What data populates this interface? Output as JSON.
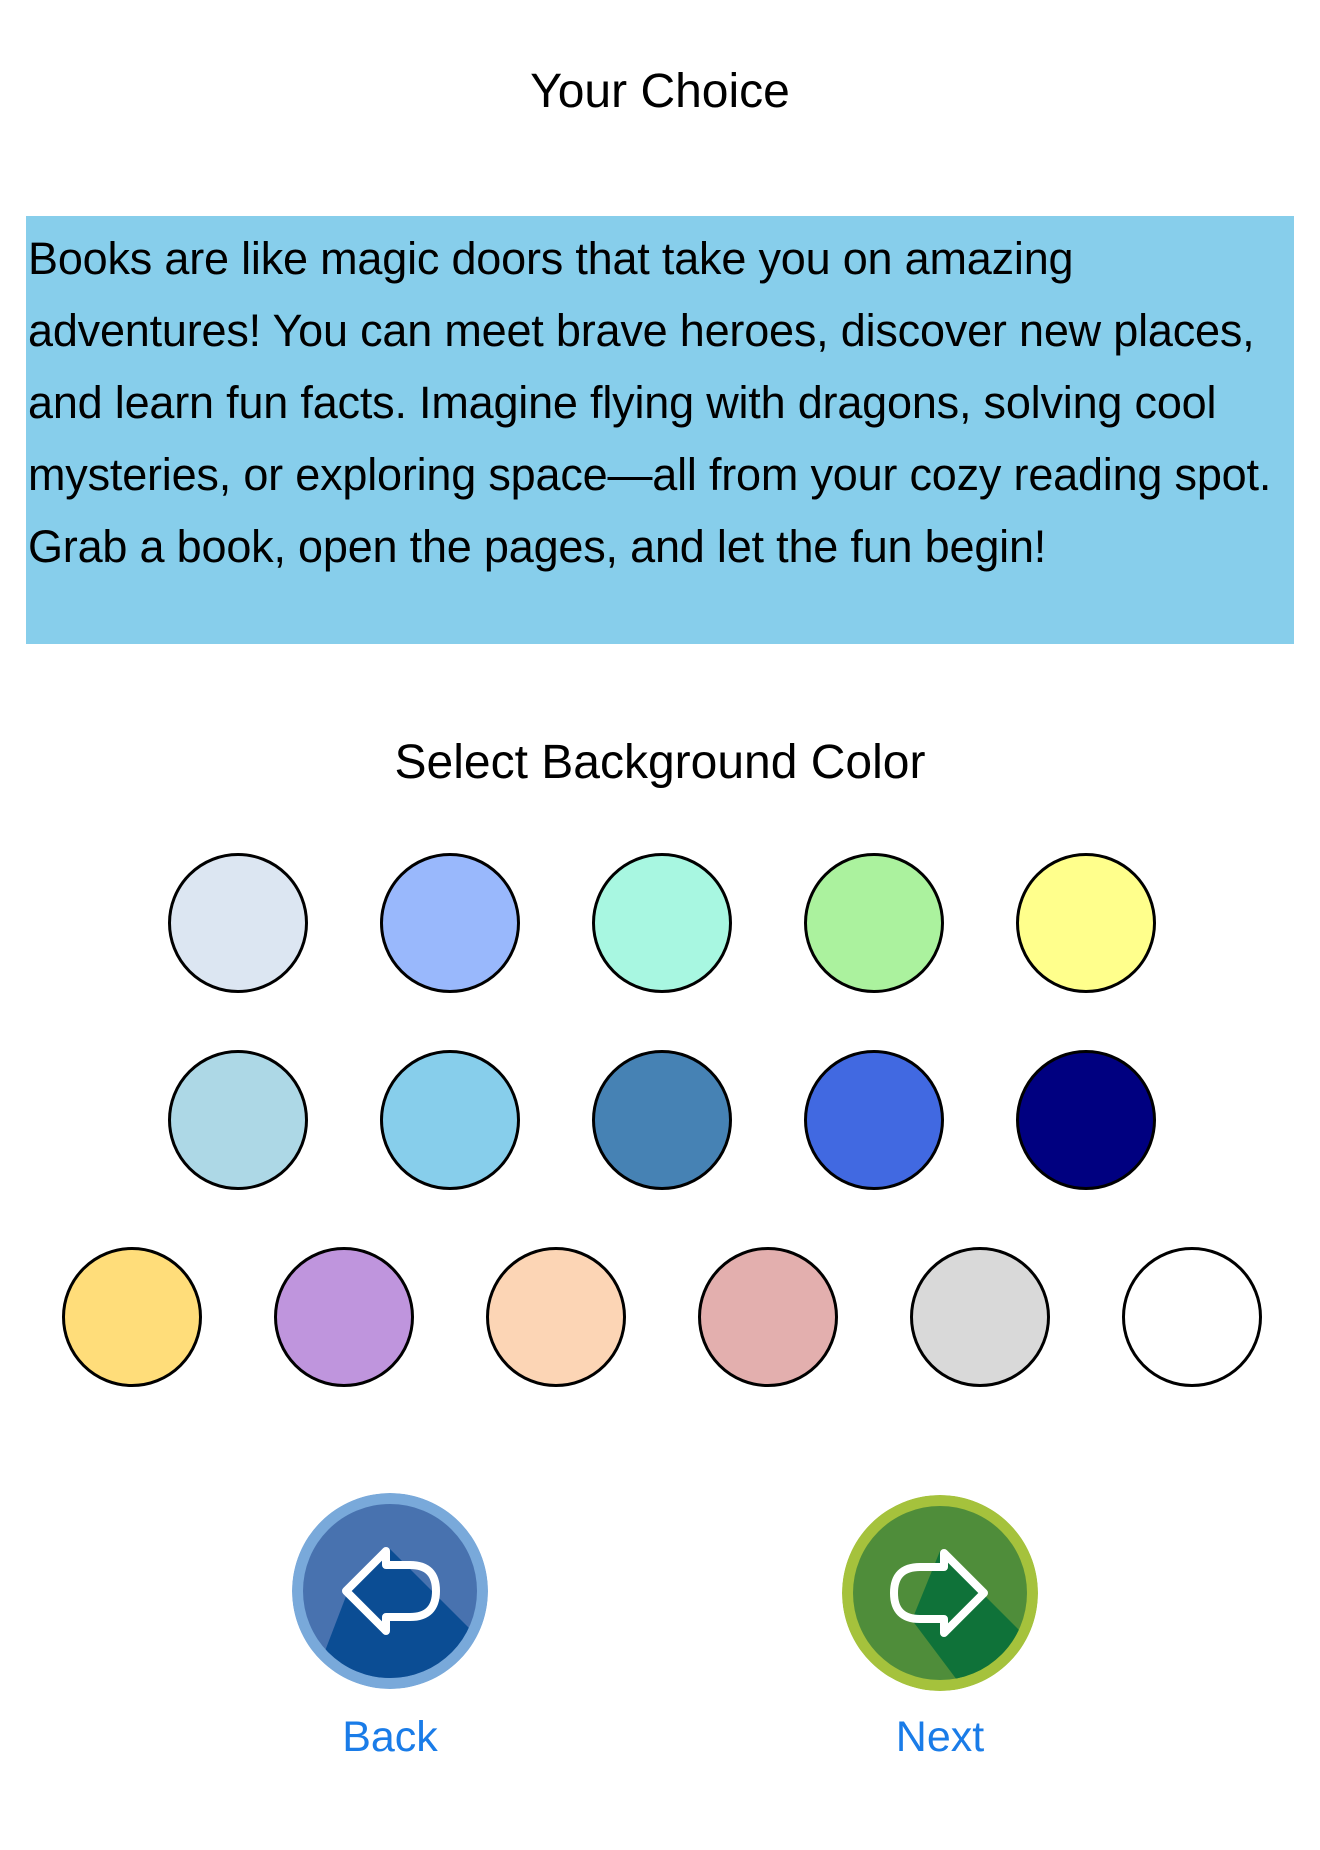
{
  "header": {
    "title": "Your Choice"
  },
  "reading": {
    "text": "Books are like magic doors that take you on amazing adventures! You can meet brave heroes, discover new places, and learn fun facts. Imagine flying with dragons, solving cool mysteries, or exploring space—all from your cozy reading spot. Grab a book, open the pages, and let the fun begin!",
    "background_color": "#87CEEB"
  },
  "color_picker": {
    "title": "Select Background Color",
    "rows": [
      [
        "#DCE6F2",
        "#99B8FC",
        "#A8F7E1",
        "#ABF29E",
        "#FFFF8C"
      ],
      [
        "#ADD8E6",
        "#87CEEB",
        "#4682B4",
        "#4169E1",
        "#000080"
      ],
      [
        "#FFDD7A",
        "#BF95DD",
        "#FCD5B5",
        "#E3AFAE",
        "#D9D9D9",
        "#FFFFFF"
      ]
    ]
  },
  "navigation": {
    "back_label": "Back",
    "next_label": "Next",
    "back_colors": {
      "ring": "#79A9DA",
      "fill": "#4872AF",
      "shadow": "#0B4D94"
    },
    "next_colors": {
      "ring": "#A5C23C",
      "fill": "#4F8D3A",
      "shadow": "#0F7239"
    },
    "label_color": "#1A7CE8"
  }
}
